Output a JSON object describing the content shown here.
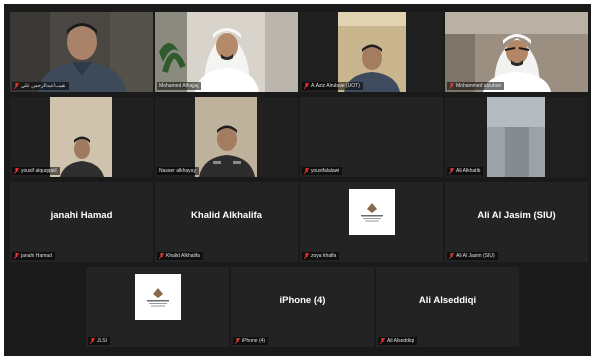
{
  "app": {
    "accent_active": "#b6c93a",
    "muted_color": "#e53935"
  },
  "participants": [
    {
      "id": "p1",
      "label": "نقيب/عبدالرحمن علي",
      "kind": "video"
    },
    {
      "id": "p2",
      "label": "Mohamed Alhajjaj",
      "kind": "video",
      "active": true
    },
    {
      "id": "p3",
      "label": "A.Aziz Alrubaie (UOT)",
      "kind": "video"
    },
    {
      "id": "p4",
      "label": "Mohammed alzubair",
      "kind": "video"
    },
    {
      "id": "p5",
      "label": "yousif alquqqaiil",
      "kind": "video"
    },
    {
      "id": "p6",
      "label": "Nasser alkhayay",
      "kind": "video"
    },
    {
      "id": "p7",
      "label": "yousifalalawi",
      "kind": "empty"
    },
    {
      "id": "p8",
      "label": "Ali Alkhatib",
      "kind": "video"
    },
    {
      "id": "p9",
      "label": "janahi Hamad",
      "display_name": "janahi Hamad",
      "kind": "name"
    },
    {
      "id": "p10",
      "label": "Khalid Alkhalifa",
      "display_name": "Khalid Alkhalifa",
      "kind": "name"
    },
    {
      "id": "p11",
      "label": "zoya khalfa",
      "kind": "logo"
    },
    {
      "id": "p12",
      "label": "Ali Al Jasim (SIU)",
      "display_name": "Ali Al Jasim (SIU)",
      "kind": "name"
    },
    {
      "id": "p13",
      "label": "JLSI",
      "kind": "logo"
    },
    {
      "id": "p14",
      "label": "iPhone (4)",
      "display_name": "iPhone (4)",
      "kind": "name"
    },
    {
      "id": "p15",
      "label": "Ali Alseddiqi",
      "display_name": "Ali Alseddiqi",
      "kind": "name"
    }
  ]
}
